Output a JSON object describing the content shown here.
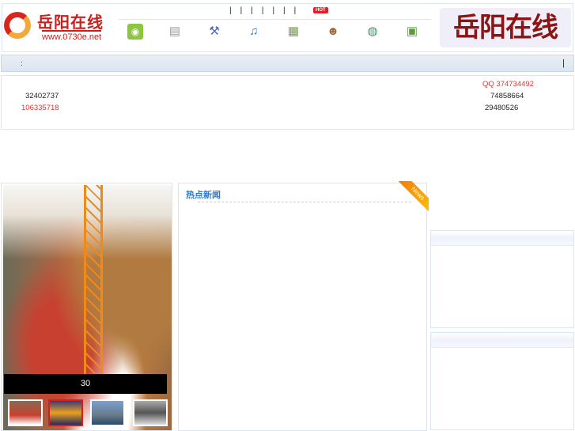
{
  "header": {
    "logo_text": "岳阳在线",
    "logo_url": "www.0730e.net",
    "top_links": [
      "|",
      "|",
      "|",
      "|",
      "|",
      "|",
      "|"
    ],
    "hot_badge": "HOT",
    "right_logo": "岳阳在线",
    "icons": [
      "rss-icon",
      "document-icon",
      "tools-icon",
      "music-icon",
      "form-icon",
      "user-icon",
      "globe-icon",
      "picture-icon"
    ]
  },
  "nav": {
    "left": ":",
    "right": "|"
  },
  "info": {
    "qq": "QQ 374734492",
    "phone1": "32402737",
    "phone2": "74858664",
    "phone3": "106335718",
    "phone4": "29480526"
  },
  "slideshow": {
    "caption": "30"
  },
  "news": {
    "title": "热点新闻",
    "ribbon": "News"
  },
  "colors": {
    "accent": "#2a7ad0",
    "red": "#e8332e"
  }
}
